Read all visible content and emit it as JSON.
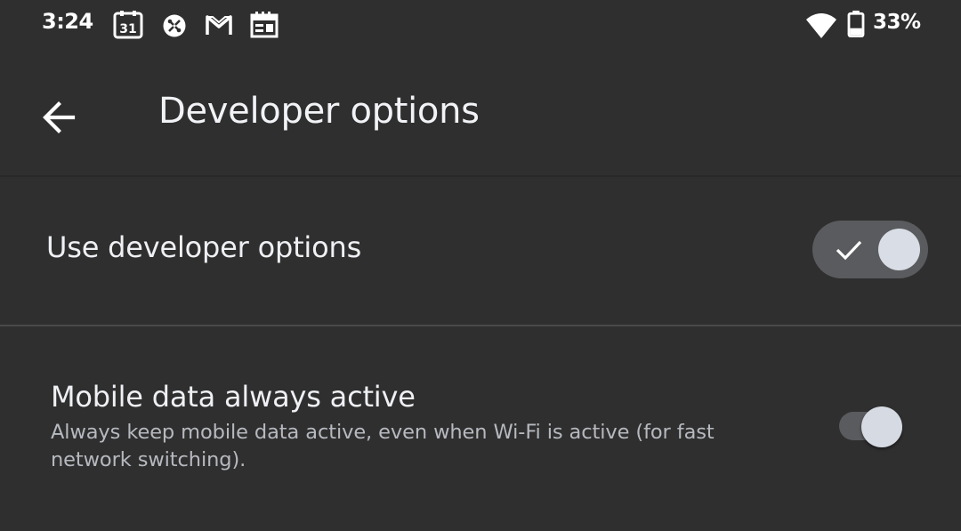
{
  "status_bar": {
    "time": "3:24",
    "notification_icons": [
      "calendar-31-icon",
      "pinwheel-icon",
      "gmail-icon",
      "news-icon"
    ],
    "calendar_day": "31",
    "wifi_icon": "wifi-icon",
    "battery_icon": "battery-icon",
    "battery_percent": "33%"
  },
  "app_bar": {
    "back_icon": "back-arrow-icon",
    "title": "Developer options"
  },
  "main_switch": {
    "label": "Use developer options",
    "checked": true
  },
  "settings": [
    {
      "title": "Mobile data always active",
      "summary": "Always keep mobile data active, even when Wi-Fi is active (for fast network switching).",
      "checked": false
    }
  ],
  "colors": {
    "background": "#2f2f2f",
    "text_primary": "#eef0f4",
    "text_secondary": "#b6b9bf",
    "switch_track": "#5a5b5e",
    "switch_thumb": "#d9dde6"
  }
}
